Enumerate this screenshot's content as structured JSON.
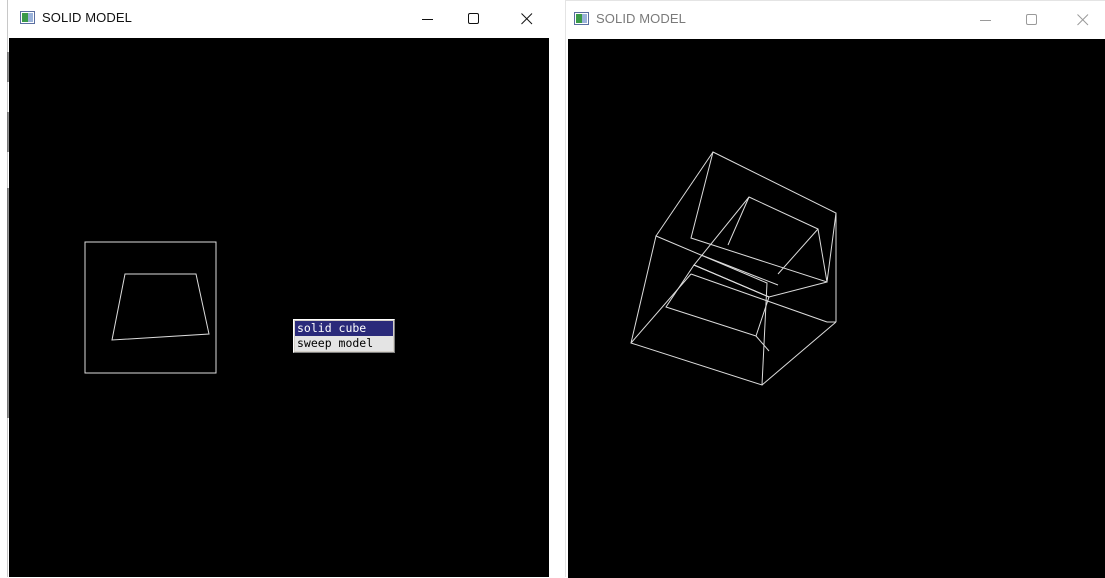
{
  "windows": [
    {
      "title": "SOLID MODEL",
      "state": "active",
      "controls": [
        "minimize",
        "maximize",
        "close"
      ]
    },
    {
      "title": "SOLID MODEL",
      "state": "inactive",
      "controls": [
        "minimize",
        "maximize",
        "close"
      ]
    }
  ],
  "popup_menu": {
    "items": [
      {
        "label": "solid cube",
        "selected": true
      },
      {
        "label": "sweep model",
        "selected": false
      }
    ]
  },
  "colors": {
    "canvas": "#000000",
    "wireframe": "#dcdcdc",
    "menu_highlight": "#2a2a7a",
    "menu_background": "#e4e4e4"
  },
  "icons": {
    "app": "app-window-icon",
    "minimize": "minimize-icon",
    "maximize": "maximize-icon",
    "close": "close-icon"
  }
}
